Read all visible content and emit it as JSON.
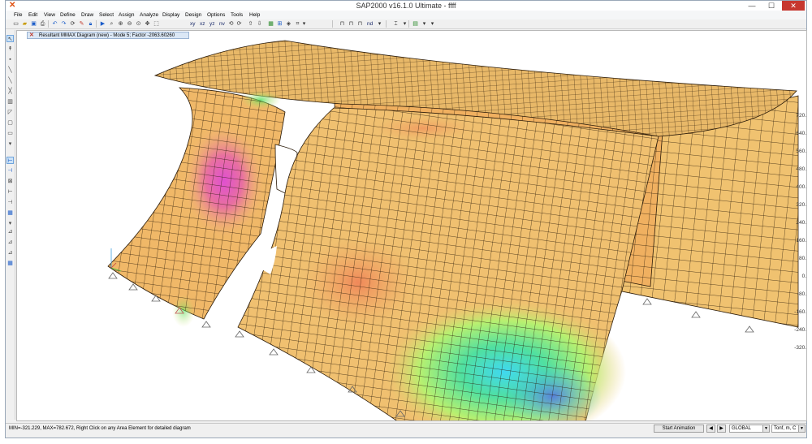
{
  "window": {
    "title": "SAP2000 v16.1.0 Ultimate  -  ffff"
  },
  "menu": [
    "File",
    "Edit",
    "View",
    "Define",
    "Draw",
    "Select",
    "Assign",
    "Analyze",
    "Display",
    "Design",
    "Options",
    "Tools",
    "Help"
  ],
  "toolbar": {
    "view_xy": "xy",
    "view_xz": "xz",
    "view_yz": "yz",
    "view_nv": "nv",
    "view_nd": "nd"
  },
  "tab": {
    "label": "Resultant MMAX Diagram  (new)  - Mode 5; Factor -2063.60260"
  },
  "legend": {
    "ticks": [
      "720.",
      "640.",
      "560.",
      "480.",
      "400.",
      "320.",
      "240.",
      "160.",
      "80.",
      "0.",
      "-80.",
      "-160.",
      "-240.",
      "-320."
    ]
  },
  "status": {
    "text": "MIN=-321.229, MAX=782.672, Right Click on any Area Element for detailed diagram",
    "animation_button": "Start Animation",
    "coord_system": "GLOBAL",
    "units": "Tonf, m, C"
  },
  "colors": {
    "close_button": "#c7372f",
    "tab_background": "#dbe7f5"
  }
}
